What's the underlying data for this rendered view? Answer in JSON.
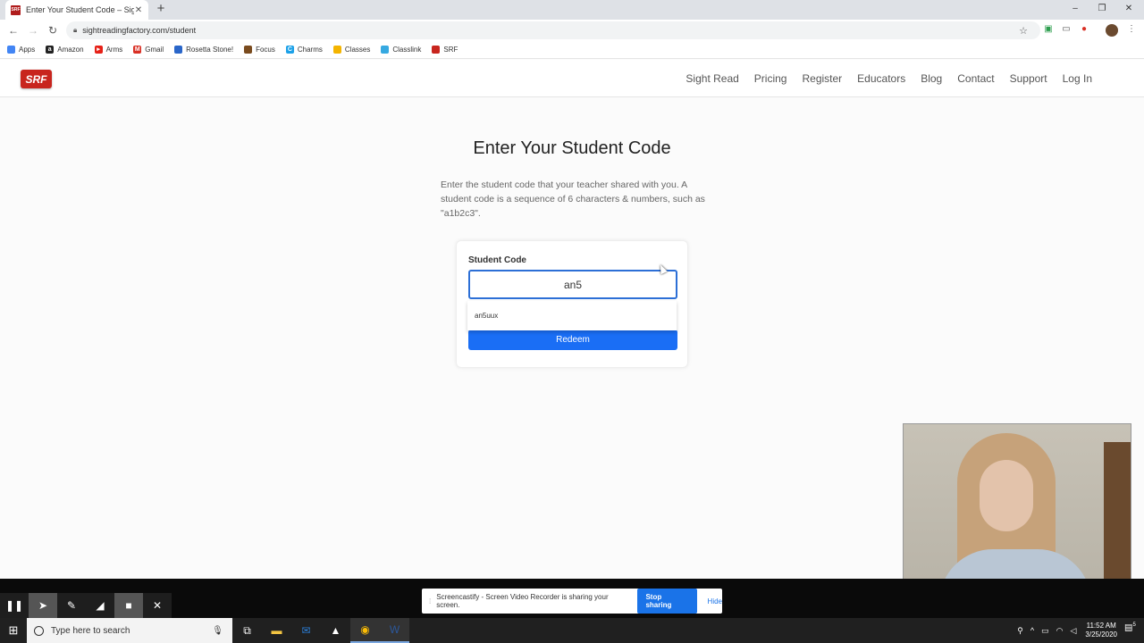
{
  "browser": {
    "tab_title": "Enter Your Student Code – Sight",
    "tab_favicon": "SRF",
    "url": "sightreadingfactory.com/student",
    "bookmarks": [
      {
        "label": "Apps",
        "icon": "apps-grid-icon",
        "color": "#4285f4"
      },
      {
        "label": "Amazon",
        "icon": "amazon-icon",
        "color": "#222222"
      },
      {
        "label": "Arms",
        "icon": "youtube-icon",
        "color": "#e62117"
      },
      {
        "label": "Gmail",
        "icon": "gmail-icon",
        "color": "#d93025"
      },
      {
        "label": "Rosetta Stone!",
        "icon": "rosetta-icon",
        "color": "#2a66c9"
      },
      {
        "label": "Focus",
        "icon": "focus-icon",
        "color": "#7a4b1e"
      },
      {
        "label": "Charms",
        "icon": "charms-icon",
        "color": "#1ca1e8"
      },
      {
        "label": "Classes",
        "icon": "classes-icon",
        "color": "#f4b400"
      },
      {
        "label": "Classlink",
        "icon": "classlink-icon",
        "color": "#36a9e1"
      },
      {
        "label": "SRF",
        "icon": "srf-icon",
        "color": "#c8251e"
      }
    ]
  },
  "site": {
    "logo_text": "SRF",
    "nav": [
      "Sight Read",
      "Pricing",
      "Register",
      "Educators",
      "Blog",
      "Contact",
      "Support",
      "Log In"
    ]
  },
  "page": {
    "title": "Enter Your Student Code",
    "intro": "Enter the student code that your teacher shared with you. A student code is a sequence of 6 characters & numbers, such as \"a1b2c3\".",
    "form": {
      "label": "Student Code",
      "value": "an5",
      "button_label": "Redeem",
      "suggestion": "an5uux"
    }
  },
  "screencastify": {
    "message": "Screencastify - Screen Video Recorder is sharing your screen.",
    "stop_label": "Stop sharing",
    "hide_label": "Hide"
  },
  "taskbar": {
    "search_placeholder": "Type here to search",
    "time": "11:52 AM",
    "date": "3/25/2020",
    "notification_count": "5"
  },
  "colors": {
    "brand_red": "#c8251e",
    "input_border": "#2c6fd6",
    "button_blue": "#1a6ef5"
  }
}
